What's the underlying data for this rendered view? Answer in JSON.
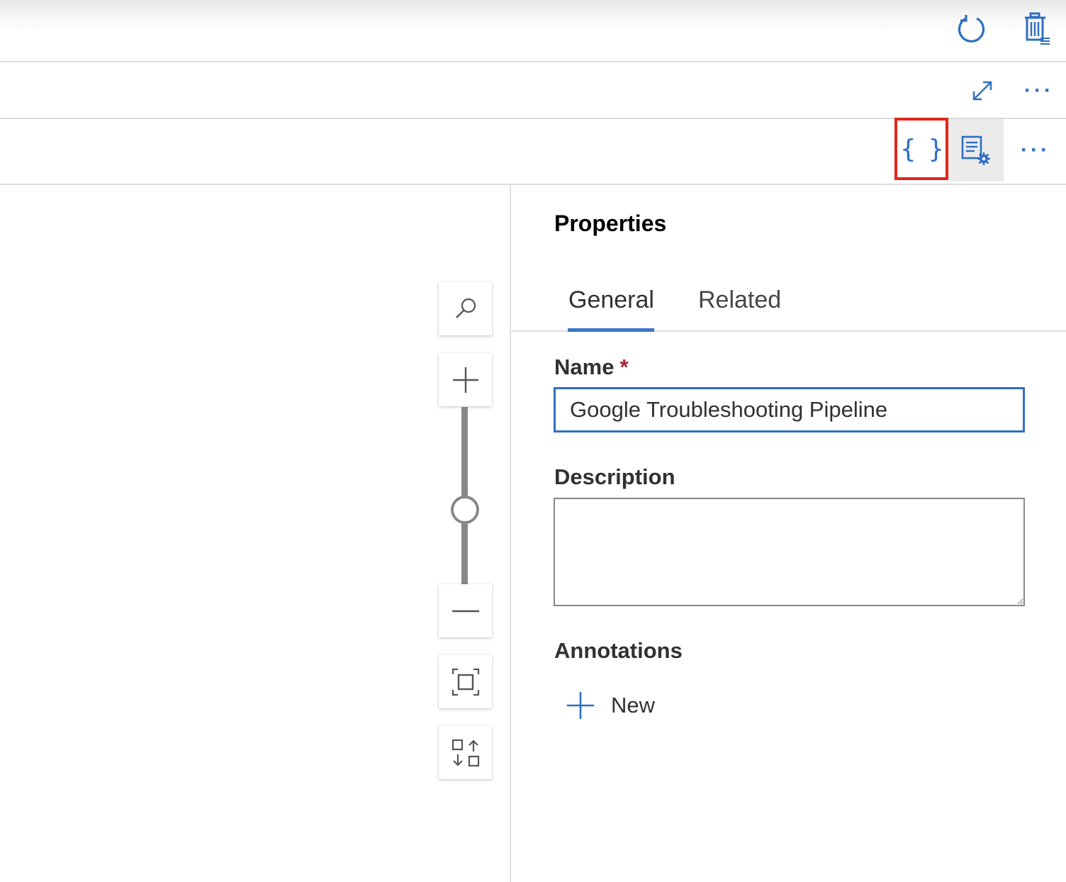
{
  "toolbar_top": {
    "refresh_icon": "refresh-icon",
    "discard_icon": "discard-all-icon"
  },
  "toolbar_canvas": {
    "expand_icon": "expand-icon",
    "more_label": "···"
  },
  "toolbar_panel": {
    "code_label": "{ }",
    "properties_icon": "properties-settings-icon",
    "more_label": "···",
    "highlight_color": "#e0261b"
  },
  "zoom_controls": {
    "search_icon": "search-icon",
    "zoom_in_icon": "plus-icon",
    "zoom_out_icon": "minus-icon",
    "fit_icon": "fit-to-screen-icon",
    "auto_align_icon": "auto-align-icon",
    "zoom_level_fraction": 0.42
  },
  "properties": {
    "title": "Properties",
    "tabs": [
      {
        "label": "General",
        "active": true
      },
      {
        "label": "Related",
        "active": false
      }
    ],
    "name": {
      "label": "Name",
      "required_mark": "*",
      "value": "Google Troubleshooting Pipeline"
    },
    "description": {
      "label": "Description",
      "value": ""
    },
    "annotations": {
      "label": "Annotations",
      "new_label": "New"
    }
  },
  "colors": {
    "accent": "#2f6fc1",
    "required": "#a4262c"
  }
}
